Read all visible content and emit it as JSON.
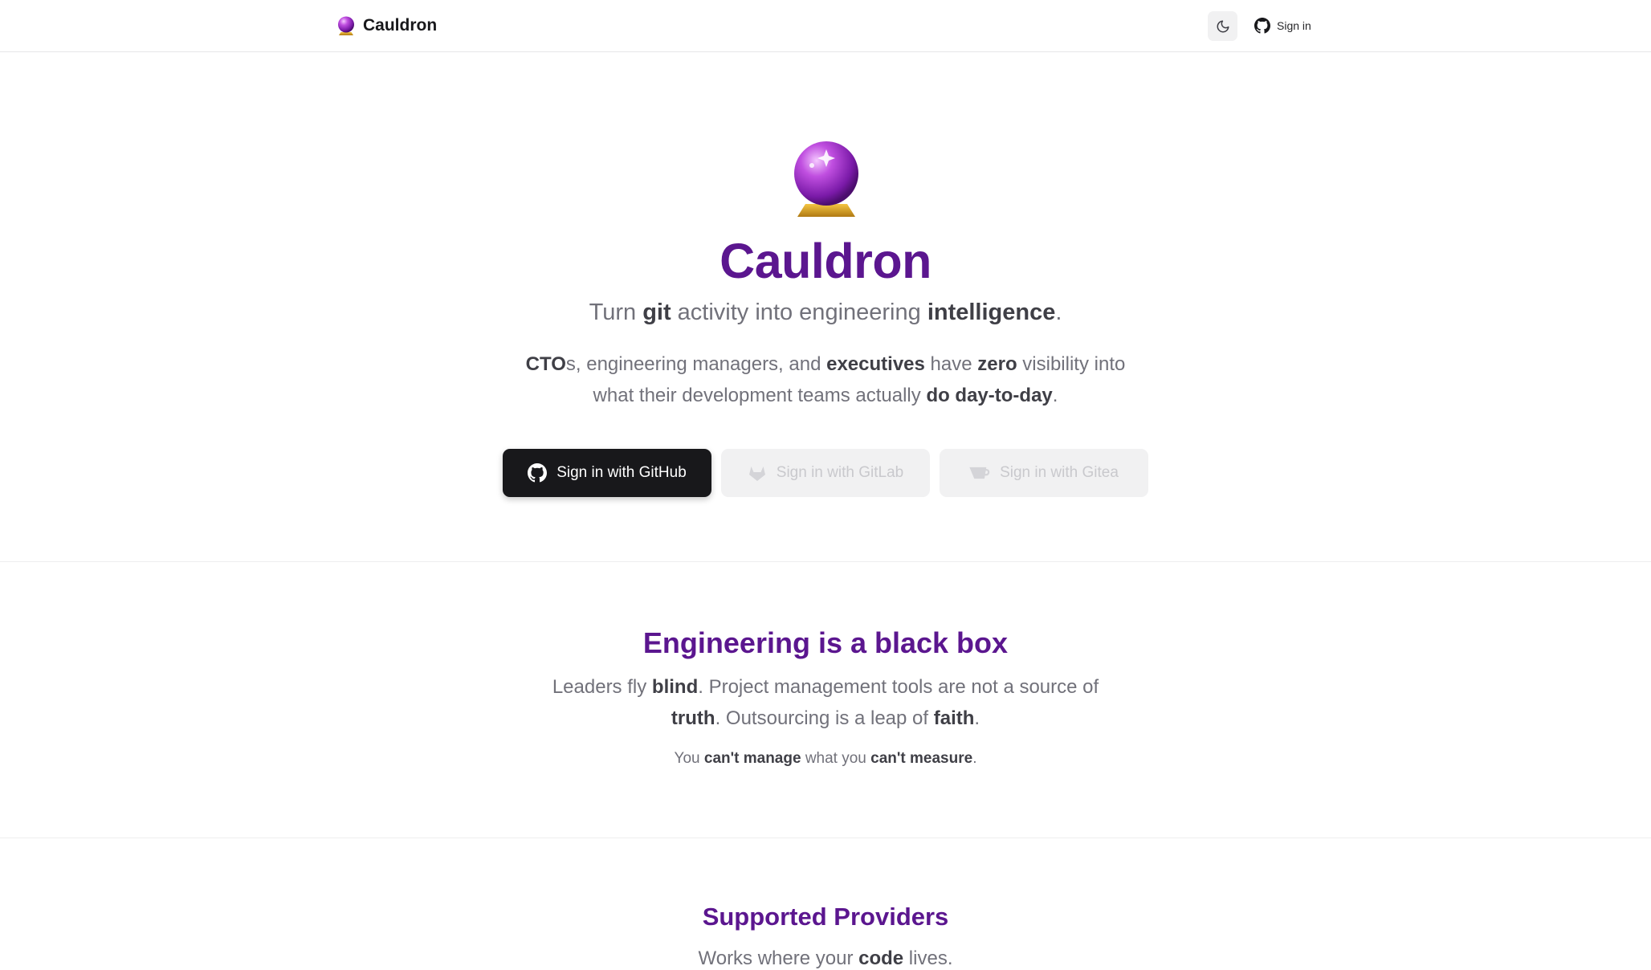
{
  "header": {
    "brand_name": "Cauldron",
    "signin_label": "Sign in"
  },
  "hero": {
    "title": "Cauldron",
    "tagline": {
      "p1": "Turn ",
      "b1": "git",
      "p2": " activity into engineering ",
      "b2": "intelligence",
      "p3": "."
    },
    "description": {
      "b1": "CTO",
      "p1": "s, engineering managers, and ",
      "b2": "executives",
      "p2": " have ",
      "b3": "zero",
      "p3": " visibility into what their development teams actually ",
      "b4": "do day-to-day",
      "p4": "."
    },
    "buttons": {
      "github": "Sign in with GitHub",
      "gitlab": "Sign in with GitLab",
      "gitea": "Sign in with Gitea"
    }
  },
  "section_black_box": {
    "title": "Engineering is a black box",
    "text": {
      "p1": "Leaders fly ",
      "b1": "blind",
      "p2": ". Project management tools are not a source of ",
      "b2": "truth",
      "p3": ". Outsourcing is a leap of ",
      "b3": "faith",
      "p4": "."
    },
    "note": {
      "p1": "You ",
      "b1": "can't manage",
      "p2": " what you ",
      "b2": "can't measure",
      "p3": "."
    }
  },
  "section_providers": {
    "title": "Supported Providers",
    "text": {
      "p1": "Works where your ",
      "b1": "code",
      "p2": " lives."
    }
  },
  "colors": {
    "accent": "#5b168f",
    "primary_button": "#18181b",
    "disabled_button": "#f1f1f2"
  },
  "icons": [
    "crystal-ball-icon",
    "moon-icon",
    "github-icon",
    "gitlab-icon",
    "gitea-icon"
  ]
}
